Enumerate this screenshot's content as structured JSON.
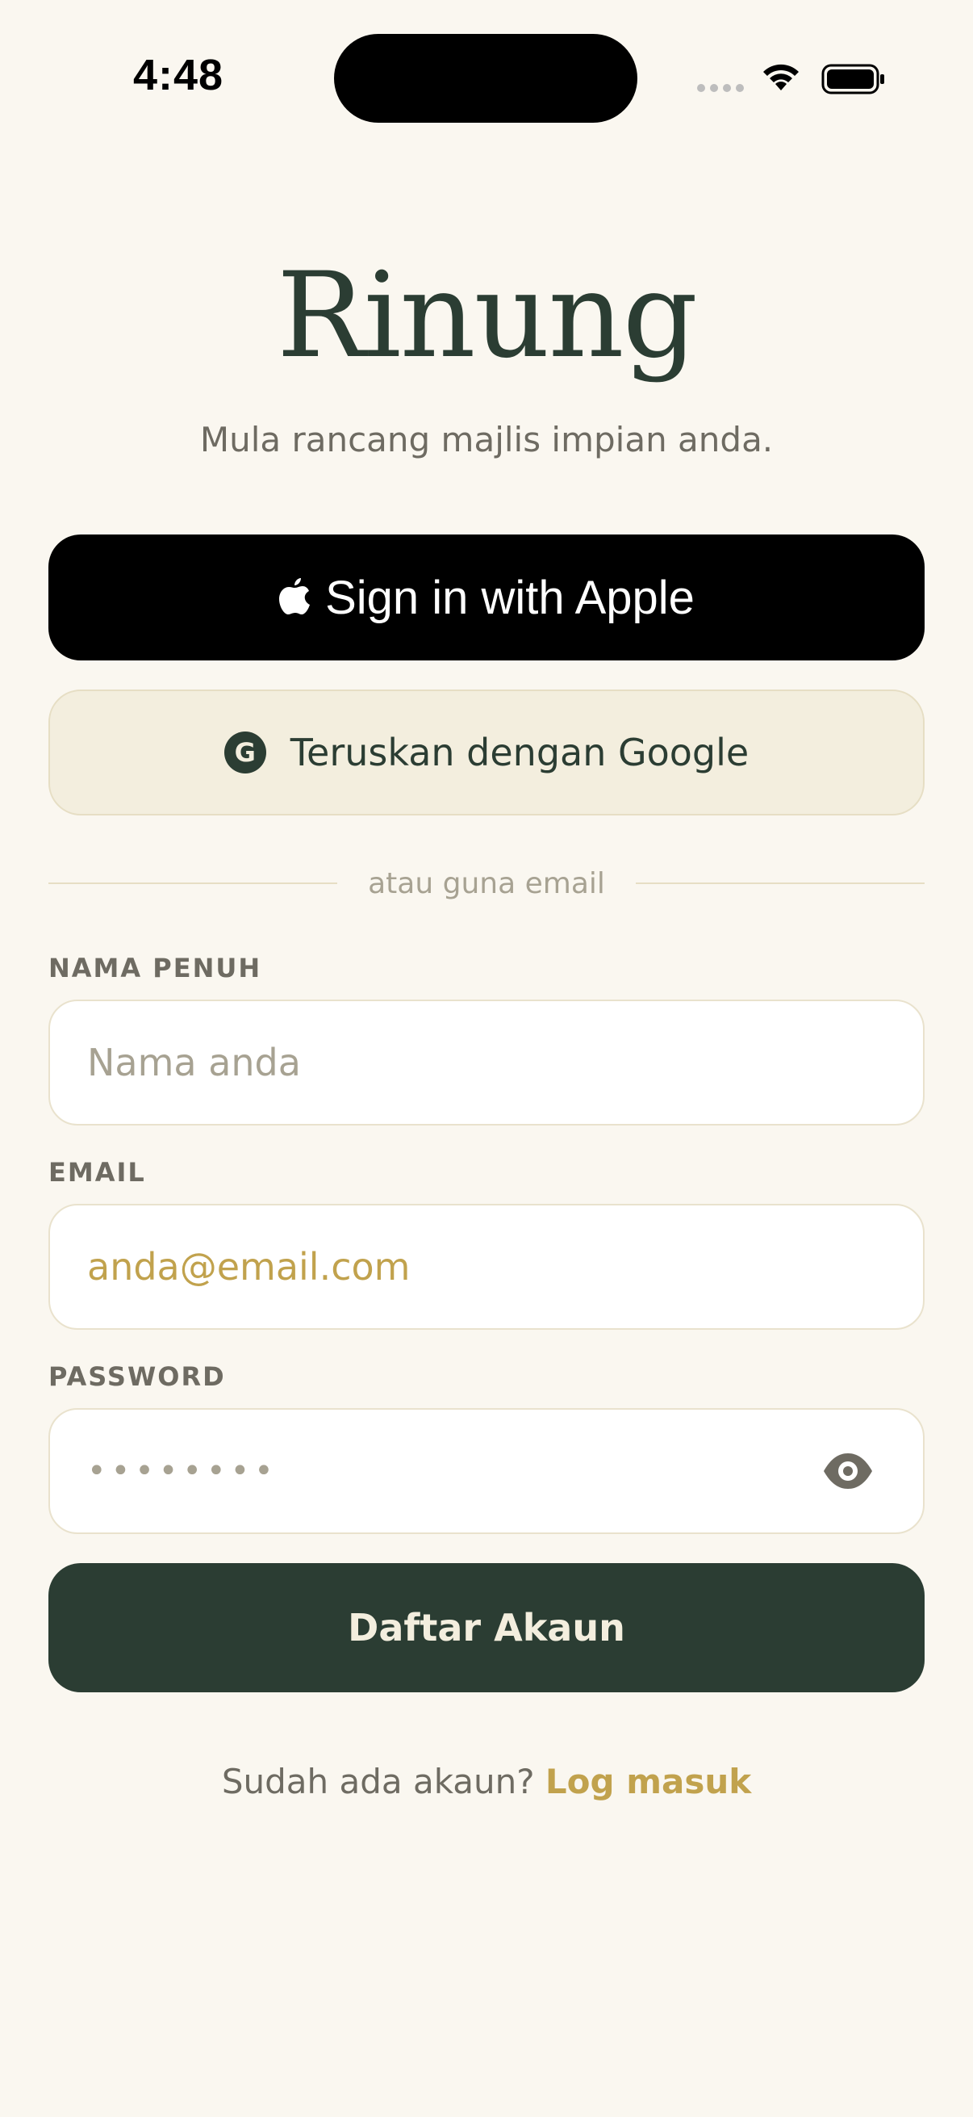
{
  "status_bar": {
    "time": "4:48"
  },
  "brand": {
    "title": "Rinung",
    "tagline": "Mula rancang majlis impian anda."
  },
  "apple_button": {
    "label": "Sign in with Apple",
    "icon": "apple-icon"
  },
  "google_button": {
    "label": "Teruskan dengan Google",
    "badge": "G",
    "icon": "google-badge-icon"
  },
  "divider": {
    "text": "atau guna email"
  },
  "form": {
    "name": {
      "label": "NAMA PENUH",
      "placeholder": "Nama anda",
      "value": ""
    },
    "email": {
      "label": "EMAIL",
      "placeholder": "anda@email.com",
      "value": ""
    },
    "password": {
      "label": "PASSWORD",
      "value": "••••••••",
      "toggle_icon": "eye-icon"
    },
    "submit_label": "Daftar Akaun"
  },
  "footer": {
    "prompt": "Sudah ada akaun?",
    "link": "Log masuk"
  },
  "colors": {
    "background": "#FAF7F0",
    "primary_dark": "#2B3D33",
    "accent_gold": "#C1A24D",
    "google_bg": "#F3EEDE",
    "muted_text": "#6E6B62"
  }
}
